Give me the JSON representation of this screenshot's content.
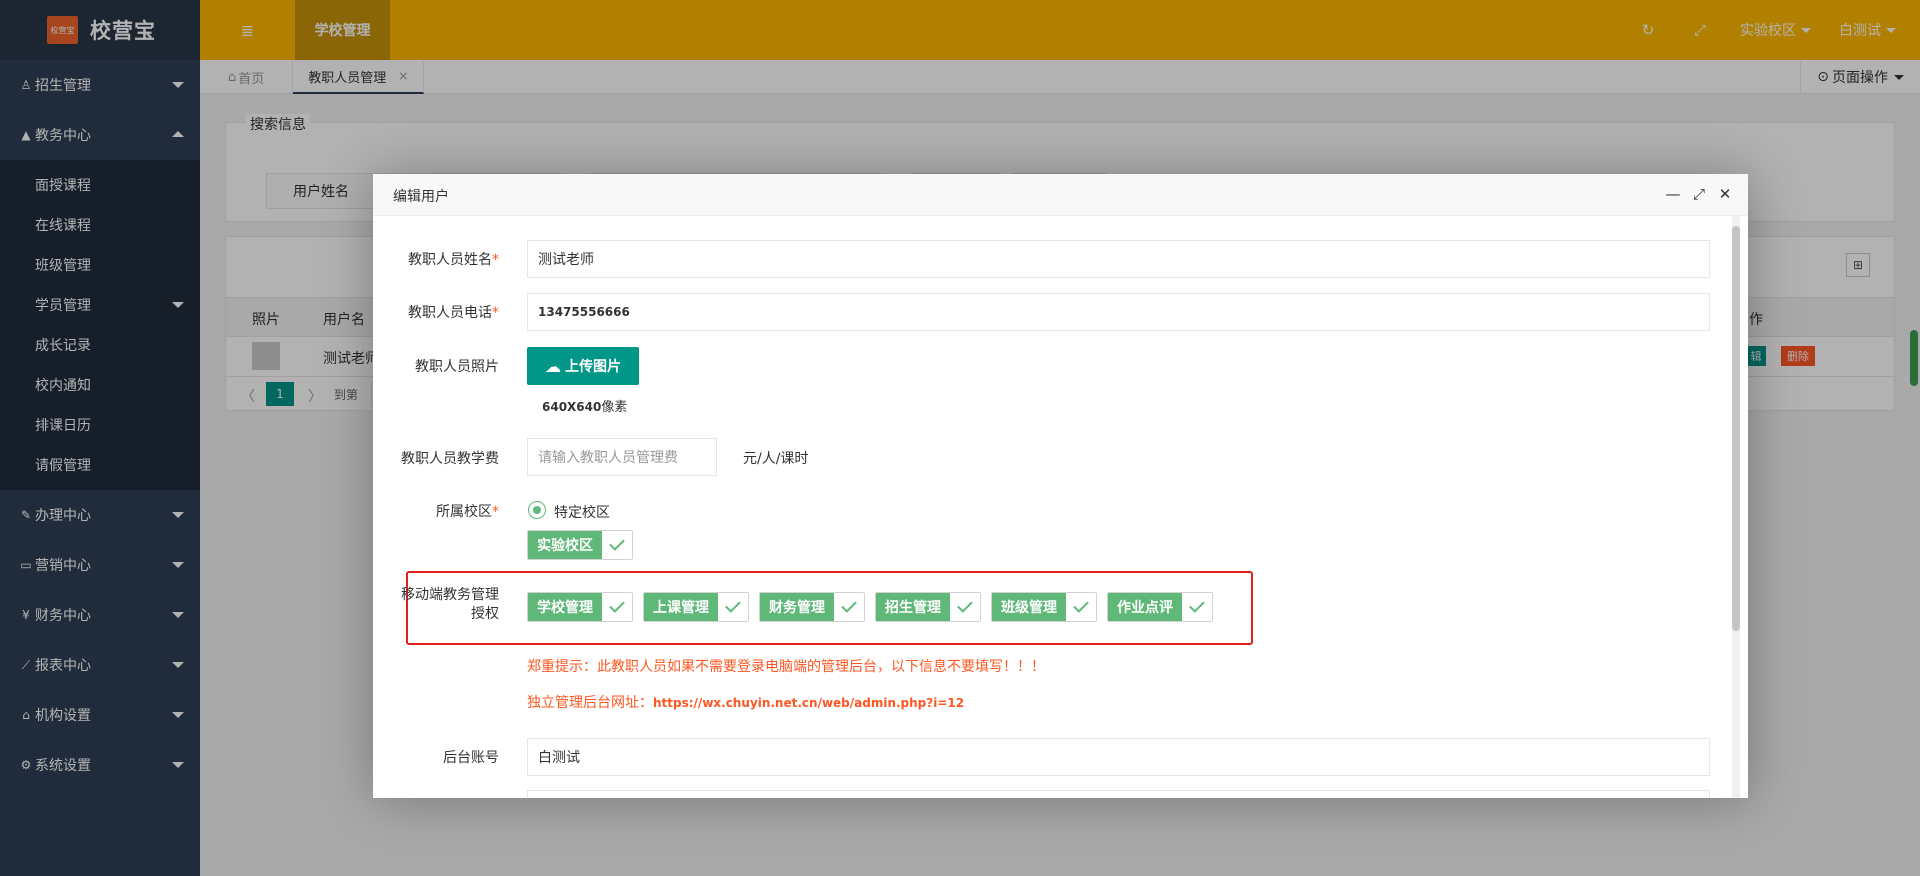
{
  "app": {
    "logo_badge": "校营宝",
    "name": "校营宝"
  },
  "sidebar": {
    "items": [
      {
        "icon": "user-icon",
        "glyph": "♙",
        "label": "招生管理"
      },
      {
        "icon": "graduation-cap-icon",
        "glyph": "🎓",
        "label": "教务中心"
      },
      {
        "icon": "edit-icon",
        "glyph": "✎",
        "label": "办理中心"
      },
      {
        "icon": "laptop-icon",
        "glyph": "▭",
        "label": "营销中心"
      },
      {
        "icon": "yen-icon",
        "glyph": "¥",
        "label": "财务中心"
      },
      {
        "icon": "chart-icon",
        "glyph": "⟋",
        "label": "报表中心"
      },
      {
        "icon": "institution-icon",
        "glyph": "⌂",
        "label": "机构设置"
      },
      {
        "icon": "gears-icon",
        "glyph": "⚙",
        "label": "系统设置"
      }
    ],
    "submenu": [
      "面授课程",
      "在线课程",
      "班级管理",
      "学员管理",
      "成长记录",
      "校内通知",
      "排课日历",
      "请假管理"
    ]
  },
  "header": {
    "menu_toggle_glyph": "≣",
    "active_tab": "学校管理",
    "refresh_glyph": "↻",
    "fullscreen_glyph": "⤢",
    "campus": "实验校区",
    "user": "白测试"
  },
  "tabs": {
    "home": "首页",
    "home_glyph": "⌂",
    "current": "教职人员管理",
    "close_glyph": "×",
    "page_ops": "页面操作",
    "page_ops_glyph": "⊙"
  },
  "background": {
    "search_legend": "搜索信息",
    "search_label": "用户姓名",
    "columns": [
      "照片",
      "用户名",
      "作"
    ],
    "row": {
      "username": "测试老师",
      "edit": "辑",
      "delete": "删除"
    },
    "pager": {
      "prev": "〈",
      "current": "1",
      "next": "〉",
      "goto": "到第"
    },
    "grid_icon_glyph": "⊞"
  },
  "modal": {
    "title": "编辑用户",
    "ctrl_min": "—",
    "ctrl_max": "⤢",
    "ctrl_close": "✕",
    "fields": {
      "name_label": "教职人员姓名",
      "name_value": "测试老师",
      "phone_label": "教职人员电话",
      "phone_value": "13475556666",
      "photo_label": "教职人员照片",
      "upload_label": "上传图片",
      "upload_glyph": "☁",
      "photo_hint_size": "640X640",
      "photo_hint_unit": "像素",
      "fee_label": "教职人员教学费",
      "fee_placeholder": "请输入教职人员管理费",
      "fee_unit": "元/人/课时",
      "campus_label": "所属校区",
      "campus_radio": "特定校区",
      "campus_selected": "实验校区",
      "auth_label_line1": "移动端教务管理",
      "auth_label_line2": "授权",
      "auth_options": [
        "学校管理",
        "上课管理",
        "财务管理",
        "招生管理",
        "班级管理",
        "作业点评"
      ],
      "warning": "郑重提示：此教职人员如果不需要登录电脑端的管理后台，以下信息不要填写！！！",
      "admin_url_label": "独立管理后台网址：",
      "admin_url": "https://wx.chuyin.net.cn/web/admin.php?i=12",
      "account_label": "后台账号",
      "account_value": "白测试"
    }
  }
}
